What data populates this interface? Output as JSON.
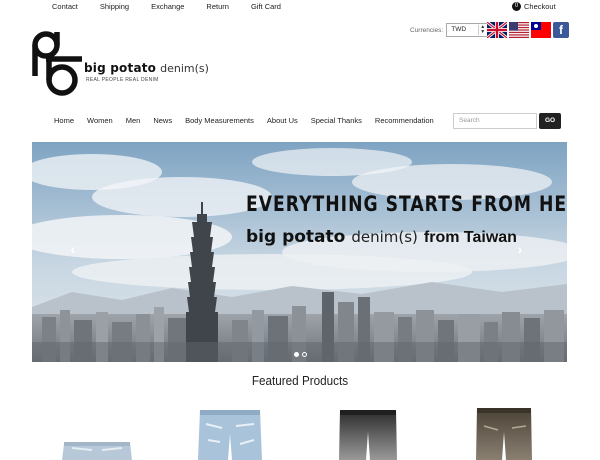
{
  "topbar": {
    "links": [
      "Contact",
      "Shipping",
      "Exchange",
      "Return",
      "Gift Card"
    ],
    "checkout_count": "0",
    "checkout_label": "Checkout"
  },
  "brand": {
    "name_bold": "big potato",
    "name_light": "denim(s)",
    "tagline": "REAL PEOPLE REAL DENIM"
  },
  "currency": {
    "label": "Currencies:",
    "selected": "TWD",
    "flags": [
      "uk-flag-icon",
      "us-flag-icon",
      "taiwan-flag-icon",
      "facebook-icon"
    ]
  },
  "nav": {
    "items": [
      "Home",
      "Women",
      "Men",
      "News",
      "Body Measurements",
      "About Us",
      "Special Thanks",
      "Recommendation"
    ],
    "search_placeholder": "Search",
    "search_button": "GO"
  },
  "hero": {
    "headline": "EVERYTHING STARTS FROM HERE",
    "sub_bold": "big potato",
    "sub_light": "denim(s)",
    "sub_tail": "from Taiwan",
    "arrow_left": "‹",
    "arrow_right": "›",
    "slides": 2,
    "active_slide": 1
  },
  "featured": {
    "title": "Featured Products",
    "products": [
      "light-wash-shorts",
      "bleached-distressed-jeans",
      "dark-faded-jeans",
      "brown-wash-jeans"
    ]
  },
  "colors": {
    "sky": "#a9c3d8",
    "city": "#8a9197",
    "go_button": "#222222",
    "facebook": "#3b5998"
  }
}
